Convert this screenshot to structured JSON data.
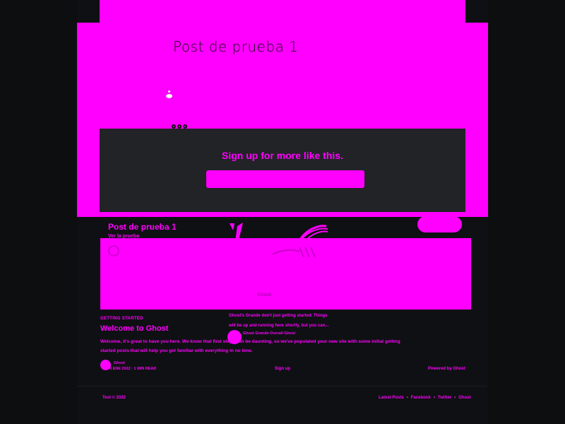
{
  "hero": {
    "title": "Post de prueba 1"
  },
  "signup_box": {
    "heading": "Sign up for more like this.",
    "button_label": ""
  },
  "featured_post": {
    "title": "Post de prueba 1",
    "subtitle": "Ver la prueba",
    "card_label": "Ghost"
  },
  "article": {
    "tag": "GETTING STARTED",
    "title": "Welcome to Ghost",
    "excerpt": "Welcome, it's great to have you here. We know that first steps can be daunting, so we've populated your new site with some initial getting started posts that will help you get familiar with everything in no time.",
    "author": "Ghost",
    "meta": "8 ENE 2022 · 1 MIN READ"
  },
  "side_post": {
    "lines": [
      "Ghost's Grande don't just getting started. Things",
      "will be up and running here shortly, but you can..."
    ],
    "byline": "Ghost Grande Overall Ghost"
  },
  "footer": {
    "signup": "Sign up",
    "powered": "Powered by Ghost",
    "copyright": "Test © 2022",
    "nav": [
      "Latest Posts",
      "Facebook",
      "Twitter",
      "Ghost"
    ]
  },
  "colors": {
    "accent": "#ff00ff",
    "background": "#0d0e10",
    "panel": "#222327"
  }
}
